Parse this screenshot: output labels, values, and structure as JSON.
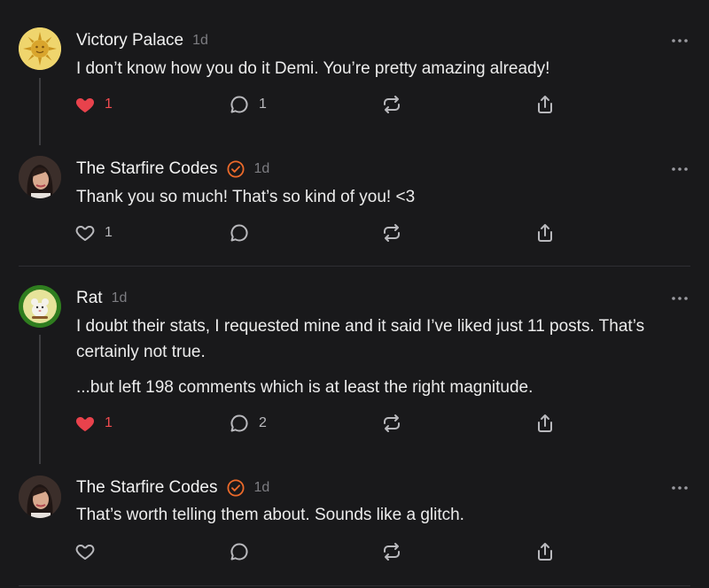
{
  "colors": {
    "background": "#19191b",
    "liked": "#e8424c",
    "verified": "#ec6a2a",
    "icon": "#b9b9bd"
  },
  "comments": [
    {
      "author": "Victory Palace",
      "time": "1d",
      "verified": false,
      "avatar": "sun-avatar",
      "paragraphs": [
        "I don’t know how you do it Demi. You’re pretty amazing already!"
      ],
      "likes": "1",
      "liked": true,
      "replies": "1"
    },
    {
      "author": "The Starfire Codes",
      "time": "1d",
      "verified": true,
      "avatar": "woman-avatar",
      "paragraphs": [
        "Thank you so much! That’s so kind of you! <3"
      ],
      "likes": "1",
      "liked": false,
      "replies": ""
    },
    {
      "author": "Rat",
      "time": "1d",
      "verified": false,
      "avatar": "rat-avatar",
      "paragraphs": [
        "I doubt their stats, I requested mine and it said I’ve liked just 11 posts. That’s certainly not true.",
        "...but left 198 comments which is at least the right magnitude."
      ],
      "likes": "1",
      "liked": true,
      "replies": "2"
    },
    {
      "author": "The Starfire Codes",
      "time": "1d",
      "verified": true,
      "avatar": "woman-avatar",
      "paragraphs": [
        "That’s worth telling them about. Sounds like a glitch."
      ],
      "likes": "",
      "liked": false,
      "replies": ""
    }
  ]
}
